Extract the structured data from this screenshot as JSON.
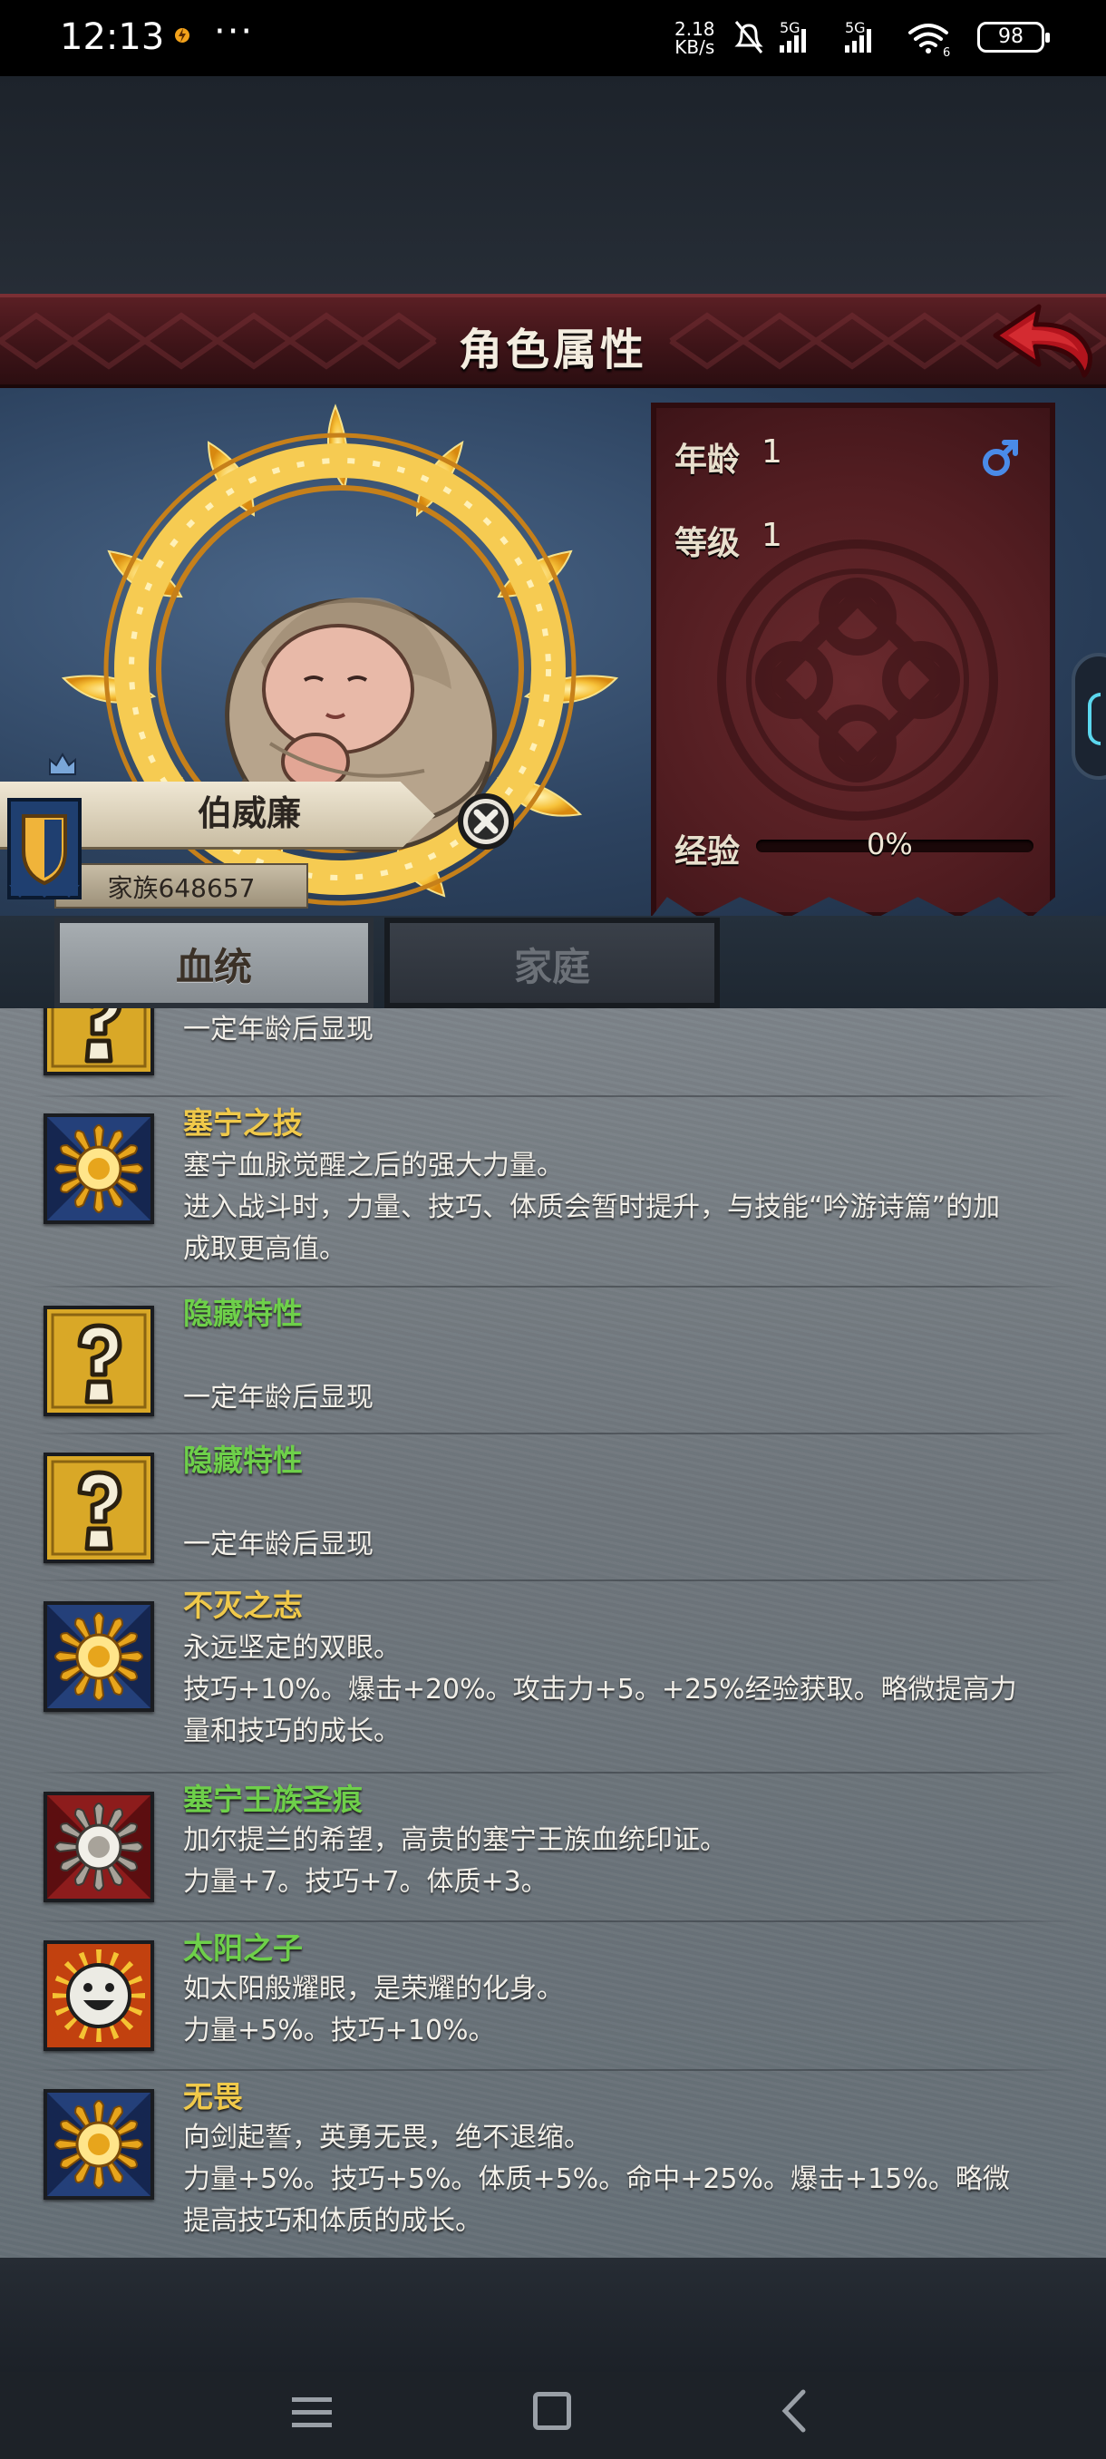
{
  "status_bar": {
    "time": "12:13",
    "dots": "···",
    "speed_value": "2.18",
    "speed_unit": "KB/s",
    "network1": "5G",
    "network2": "5G",
    "wifi_badge": "6",
    "battery": "98"
  },
  "header": {
    "title": "角色属性"
  },
  "character": {
    "name": "伯威廉",
    "family": "家族648657",
    "age_label": "年龄",
    "age_value": "1",
    "level_label": "等级",
    "level_value": "1",
    "exp_label": "经验",
    "exp_value": "0%",
    "exp_progress": 0,
    "gender_icon": "male-icon"
  },
  "tabs": [
    {
      "label": "血统",
      "active": true
    },
    {
      "label": "家庭",
      "active": false
    }
  ],
  "traits": [
    {
      "icon": "question-icon",
      "name": "",
      "name_color": "green",
      "lines": [
        "一定年龄后显现"
      ]
    },
    {
      "icon": "golden-sun-icon",
      "name": "塞宁之技",
      "name_color": "gold",
      "lines": [
        "塞宁血脉觉醒之后的强大力量。",
        "进入战斗时，力量、技巧、体质会暂时提升，与技能“吟游诗篇”的加",
        "成取更高值。"
      ]
    },
    {
      "icon": "question-icon",
      "name": "隐藏特性",
      "name_color": "green",
      "lines": [
        "",
        "一定年龄后显现"
      ]
    },
    {
      "icon": "question-icon",
      "name": "隐藏特性",
      "name_color": "green",
      "lines": [
        "",
        "一定年龄后显现"
      ]
    },
    {
      "icon": "golden-sun-icon",
      "name": "不灭之志",
      "name_color": "gold",
      "lines": [
        "永远坚定的双眼。",
        "技巧+10%。爆击+20%。攻击力+5。+25%经验获取。略微提高力",
        "量和技巧的成长。"
      ]
    },
    {
      "icon": "silver-sun-icon",
      "name": "塞宁王族圣痕",
      "name_color": "green",
      "lines": [
        "加尔提兰的希望，高贵的塞宁王族血统印证。",
        "力量+7。技巧+7。体质+3。"
      ]
    },
    {
      "icon": "smiley-face-icon",
      "name": "太阳之子",
      "name_color": "green",
      "lines": [
        "如太阳般耀眼，是荣耀的化身。",
        "力量+5%。技巧+10%。"
      ]
    },
    {
      "icon": "golden-sun-icon",
      "name": "无畏",
      "name_color": "gold",
      "lines": [
        "向剑起誓，英勇无畏，绝不退缩。",
        "力量+5%。技巧+5%。体质+5%。命中+25%。爆击+15%。略微",
        "提高技巧和体质的成长。"
      ]
    }
  ],
  "colors": {
    "gold_name": "#f0c94a",
    "green_name": "#6ed04a",
    "header_red": "#4a181c",
    "panel_red": "#5a1f23"
  }
}
